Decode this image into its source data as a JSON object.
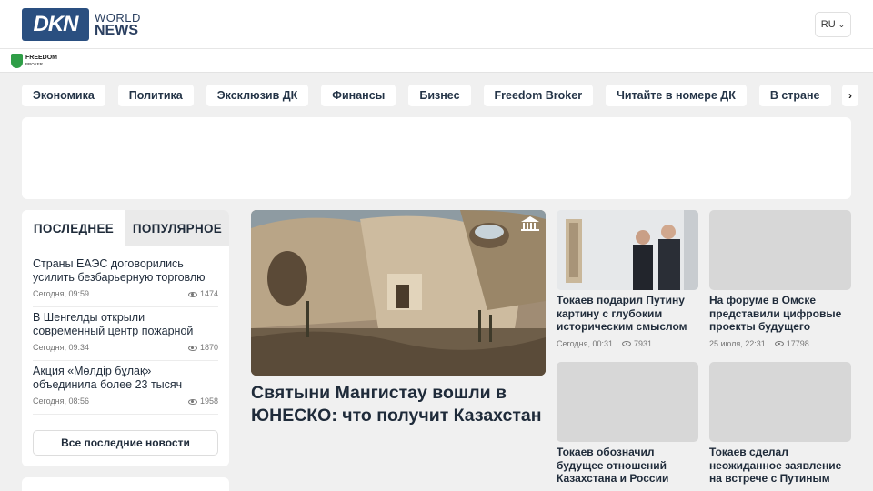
{
  "header": {
    "logo_main": "DKN",
    "logo_line1": "WORLD",
    "logo_line2": "NEWS",
    "language": "RU"
  },
  "sponsor": {
    "name": "FREEDOM",
    "sub": "BROKER"
  },
  "categories": [
    "Экономика",
    "Политика",
    "Эксклюзив ДК",
    "Финансы",
    "Бизнес",
    "Freedom Broker",
    "Читайте в номере ДК",
    "В стране"
  ],
  "sidebar": {
    "tab_latest": "ПОСЛЕДНЕЕ",
    "tab_popular": "ПОПУЛЯРНОЕ",
    "items": [
      {
        "title": "Страны ЕАЭС договорились усилить безбарьерную торговлю",
        "time": "Сегодня, 09:59",
        "views": "1474"
      },
      {
        "title": "В Шенгелды открыли современный центр пожарной службы",
        "time": "Сегодня, 09:34",
        "views": "1870"
      },
      {
        "title": "Акция «Мөлдір бұлақ» объединила более 23 тысяч казахстанцев",
        "time": "Сегодня, 08:56",
        "views": "1958"
      }
    ],
    "all_news_button": "Все последние новости"
  },
  "featured": {
    "title": "Святыни Мангистау вошли в ЮНЕСКО: что получит Казахстан"
  },
  "cards": [
    {
      "title": "Токаев подарил Путину картину с глубоким историческим смыслом",
      "time": "Сегодня, 00:31",
      "views": "7931"
    },
    {
      "title": "На форуме в Омске представили цифровые проекты будущего",
      "time": "25 июля, 22:31",
      "views": "17798"
    },
    {
      "title": "Токаев обозначил будущее отношений Казахстана и России",
      "time": "",
      "views": ""
    },
    {
      "title": "Токаев сделал неожиданное заявление на встрече с Путиным",
      "time": "",
      "views": ""
    }
  ]
}
